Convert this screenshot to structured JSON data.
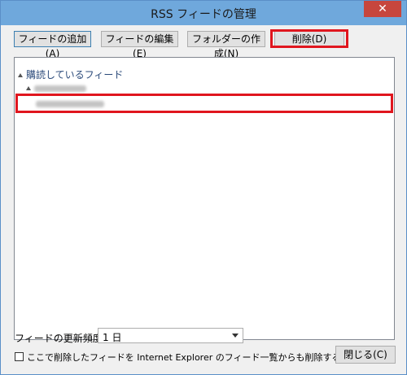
{
  "window": {
    "title": "RSS フィードの管理",
    "close_glyph": "✕"
  },
  "toolbar": {
    "add_label": "フィードの追加(A)",
    "edit_label": "フィードの編集(E)",
    "folder_label": "フォルダーの作成(N)",
    "delete_label": "削除(D)"
  },
  "tree": {
    "root_label": "購読しているフィード"
  },
  "update": {
    "label": "フィードの更新頻度(U):",
    "value": "1 日"
  },
  "checkbox": {
    "label": "ここで削除したフィードを Internet Explorer のフィード一覧からも削除する(F)",
    "checked": false
  },
  "footer": {
    "close_label": "閉じる(C)"
  },
  "colors": {
    "highlight": "#e0161e",
    "titlebar": "#6fa8dc",
    "close": "#c7463d"
  }
}
